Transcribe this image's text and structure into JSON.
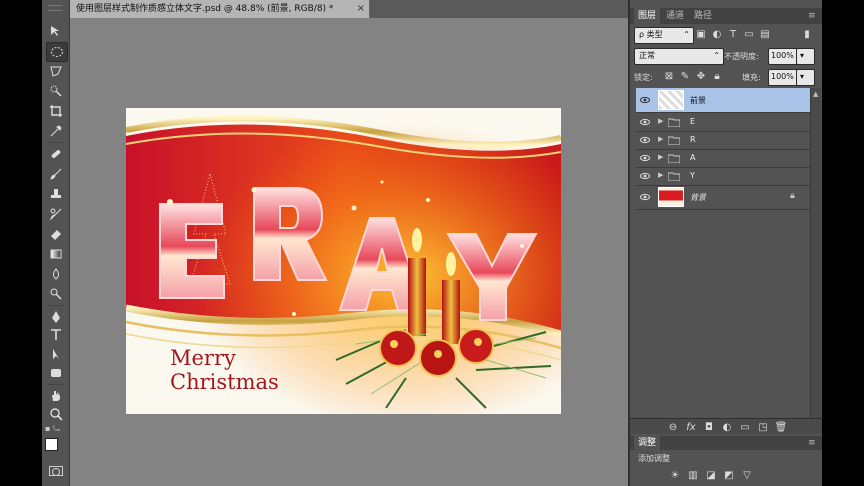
{
  "document": {
    "tab_title": "使用图层样式制作质感立体文字.psd @ 48.8% (前景, RGB/8) *",
    "close": "×"
  },
  "canvas": {
    "big_letters": [
      "E",
      "R",
      "A",
      "Y"
    ],
    "greeting_line1": "Merry",
    "greeting_line2": "Christmas"
  },
  "panel": {
    "tabs": [
      "图层",
      "通道",
      "路径"
    ],
    "filter_kind": "ρ 类型",
    "blend_mode": "正常",
    "opacity_label": "不透明度:",
    "opacity_value": "100%",
    "lock_label": "锁定:",
    "fill_label": "填充:",
    "fill_value": "100%",
    "layers": [
      {
        "name": "前景",
        "type": "pixel",
        "selected": true
      },
      {
        "name": "E",
        "type": "group"
      },
      {
        "name": "R",
        "type": "group"
      },
      {
        "name": "A",
        "type": "group"
      },
      {
        "name": "Y",
        "type": "group"
      },
      {
        "name": "背景",
        "type": "background",
        "locked": true
      }
    ],
    "adjust_tab": "调整",
    "adjust_title": "添加调整"
  },
  "colors": {
    "panel_bg": "#535353",
    "workspace": "#838383",
    "selection": "#a8c2e8",
    "christmas_red": "#a3171c"
  }
}
